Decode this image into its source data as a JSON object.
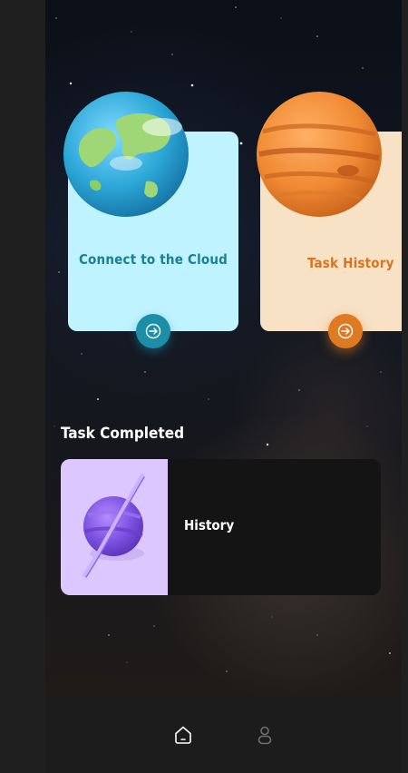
{
  "cards": [
    {
      "title": "Connect to the Cloud",
      "icon": "earth-icon",
      "accent": "#1c8ea8",
      "background": "#bff3ff"
    },
    {
      "title": "Task History",
      "icon": "jupiter-icon",
      "accent": "#de7a22",
      "background": "#f7e2c6"
    }
  ],
  "section": {
    "title": "Task Completed"
  },
  "tasks": [
    {
      "label": "History",
      "icon": "saturn-icon",
      "thumb_color": "#dcc8ff"
    }
  ],
  "nav": {
    "items": [
      {
        "icon": "home-icon",
        "active": true
      },
      {
        "icon": "profile-icon",
        "active": false
      }
    ]
  }
}
